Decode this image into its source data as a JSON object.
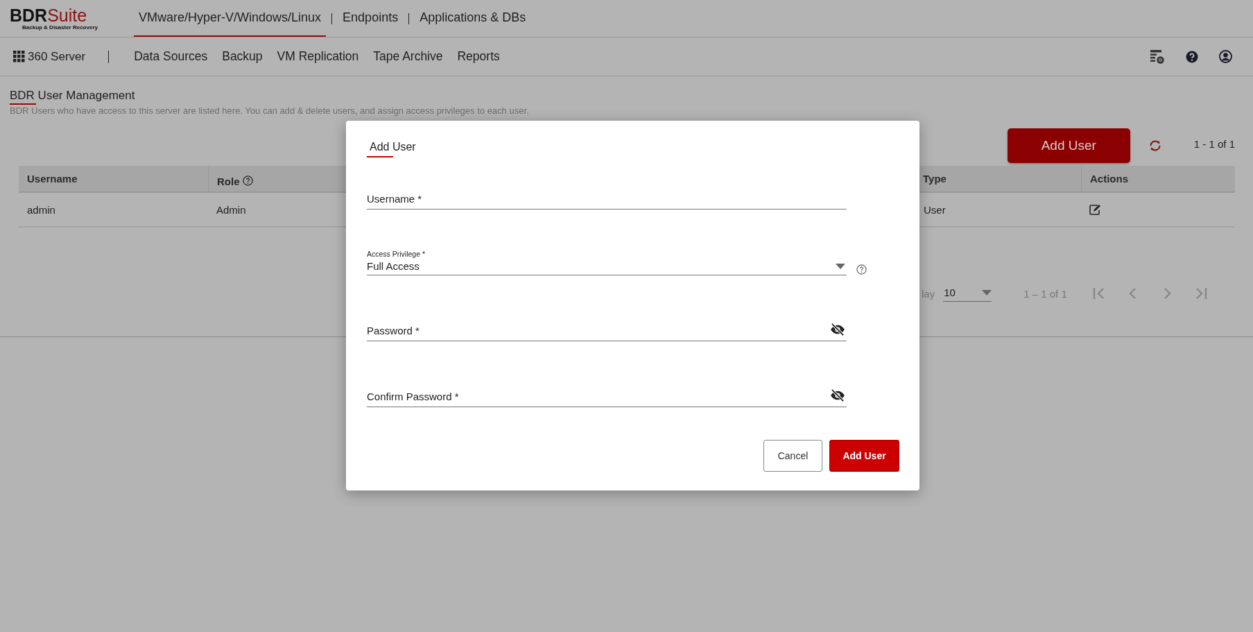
{
  "header": {
    "logo": {
      "brand_dark": "BDR",
      "brand_accent": "Suite",
      "tagline": "Backup & Disaster Recovery"
    },
    "tabs": [
      {
        "label": "VMware/Hyper-V/Windows/Linux",
        "selected": true
      },
      {
        "label": "Endpoints",
        "selected": false
      },
      {
        "label": "Applications & DBs",
        "selected": false
      }
    ]
  },
  "nav": {
    "server": "360 Server",
    "items": [
      "Data Sources",
      "Backup",
      "VM Replication",
      "Tape Archive",
      "Reports"
    ]
  },
  "page": {
    "title": "BDR User Management",
    "description": "BDR Users who have access to this server are listed here. You can add & delete users, and assign access privileges to each user.",
    "add_button": "Add User",
    "count": "1 - 1 of 1",
    "table": {
      "columns": [
        {
          "label": "Username",
          "help": false
        },
        {
          "label": "Role",
          "help": true
        },
        {
          "label": "Type",
          "help": false
        },
        {
          "label": "Actions",
          "help": false
        }
      ],
      "rows": [
        {
          "username": "admin",
          "role": "Admin",
          "type": "User"
        }
      ]
    },
    "pagination": {
      "per_page_label": "lay",
      "per_page": "10",
      "range": "1 – 1 of 1"
    }
  },
  "dialog": {
    "title": "Add User",
    "fields": [
      {
        "kind": "text",
        "placeholder": "Username *"
      },
      {
        "kind": "select",
        "label": "Access Privilege *",
        "value": "Full Access",
        "help": true
      },
      {
        "kind": "password",
        "placeholder": "Password *"
      },
      {
        "kind": "password",
        "placeholder": "Confirm Password *"
      }
    ],
    "buttons": [
      {
        "label": "Cancel",
        "kind": "secondary"
      },
      {
        "label": "Add User",
        "kind": "primary"
      }
    ]
  }
}
